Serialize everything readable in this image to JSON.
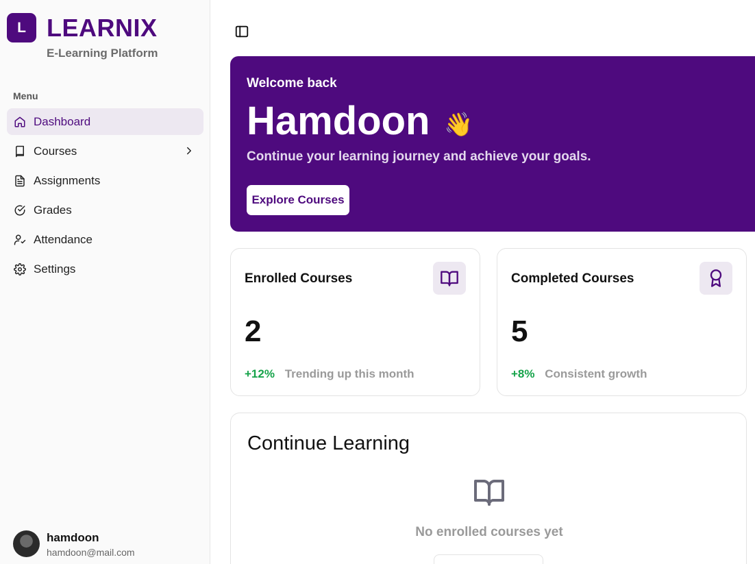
{
  "brand": {
    "letter": "L",
    "name": "LEARNIX",
    "subtitle": "E-Learning Platform",
    "color": "#4e0a7e"
  },
  "sidebar": {
    "menu_label": "Menu",
    "items": [
      {
        "label": "Dashboard",
        "icon": "home-icon",
        "active": true
      },
      {
        "label": "Courses",
        "icon": "book-icon",
        "has_chevron": true
      },
      {
        "label": "Assignments",
        "icon": "file-text-icon"
      },
      {
        "label": "Grades",
        "icon": "check-circle-icon"
      },
      {
        "label": "Attendance",
        "icon": "user-check-icon"
      },
      {
        "label": "Settings",
        "icon": "gear-icon"
      }
    ]
  },
  "user": {
    "name": "hamdoon",
    "email": "hamdoon@mail.com"
  },
  "hero": {
    "welcome": "Welcome back",
    "name": "Hamdoon",
    "wave": "👋",
    "subtitle": "Continue your learning journey and achieve your goals.",
    "button": "Explore Courses"
  },
  "stats": [
    {
      "title": "Enrolled Courses",
      "value": "2",
      "delta": "+12%",
      "note": "Trending up this month",
      "icon": "book-open-icon"
    },
    {
      "title": "Completed Courses",
      "value": "5",
      "delta": "+8%",
      "note": "Consistent growth",
      "icon": "award-icon"
    }
  ],
  "continue_learning": {
    "title": "Continue Learning",
    "empty_text": "No enrolled courses yet"
  },
  "colors": {
    "accent": "#4e0a7e",
    "positive": "#16a34a",
    "muted": "#9a9a9a",
    "active_bg": "#ede8f1"
  }
}
